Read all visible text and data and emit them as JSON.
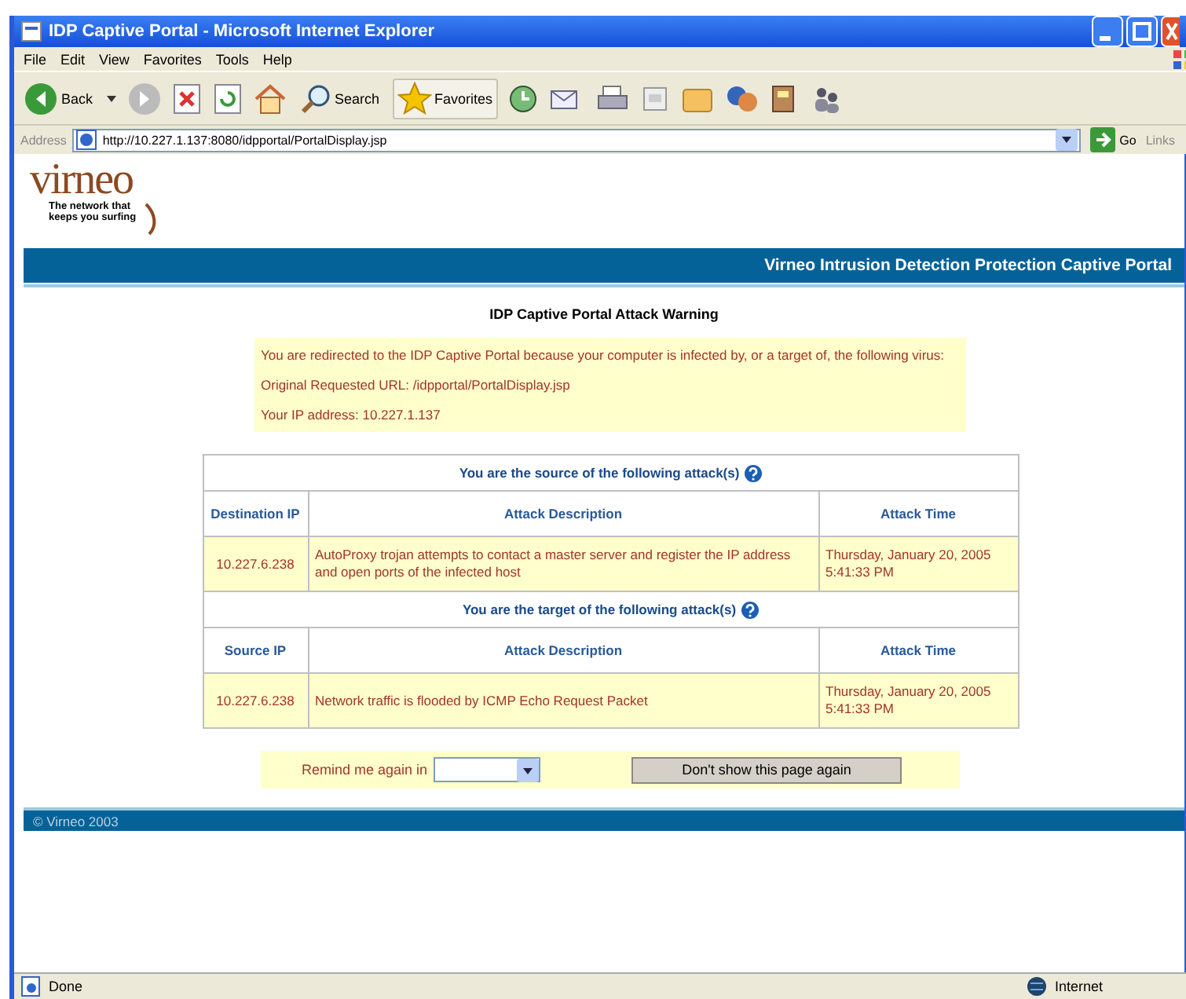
{
  "window": {
    "title": "IDP Captive Portal - Microsoft Internet Explorer"
  },
  "menu": [
    "File",
    "Edit",
    "View",
    "Favorites",
    "Tools",
    "Help"
  ],
  "toolbar": {
    "back": "Back",
    "search": "Search",
    "favorites": "Favorites"
  },
  "address_bar": {
    "label": "Address",
    "url": "http://10.227.1.137:8080/idpportal/PortalDisplay.jsp",
    "go": "Go",
    "links": "Links"
  },
  "logo": {
    "name": "virneo",
    "tagline": "The network that keeps you surfing"
  },
  "banner": "Virneo Intrusion Detection Protection Captive Portal",
  "heading": "IDP Captive Portal Attack Warning",
  "notice": [
    "You are redirected to the IDP Captive Portal because your computer is infected by, or a target of, the following virus:",
    "Original Requested URL: /idpportal/PortalDisplay.jsp",
    "Your IP address: 10.227.1.137"
  ],
  "attack_tables": [
    {
      "title": "You are the source of the following attack(s)",
      "columns": [
        "Destination IP",
        "Attack Description",
        "Attack Time"
      ],
      "rows": [
        [
          "10.227.6.238",
          "AutoProxy trojan attempts to contact a master server and register the IP address and open ports of the infected host",
          "Thursday, January 20, 2005 5:41:33 PM"
        ]
      ]
    },
    {
      "title": "You are the target of the following attack(s)",
      "columns": [
        "Source IP",
        "Attack Description",
        "Attack Time"
      ],
      "rows": [
        [
          "10.227.6.238",
          "Network traffic is flooded by ICMP Echo Request Packet",
          "Thursday, January 20, 2005 5:41:33 PM"
        ]
      ]
    }
  ],
  "remind": {
    "label": "Remind me again in",
    "button": "Don't show this page again"
  },
  "footer": "© Virneo 2003",
  "status_bar": {
    "text": "Done",
    "zone": "Internet"
  }
}
